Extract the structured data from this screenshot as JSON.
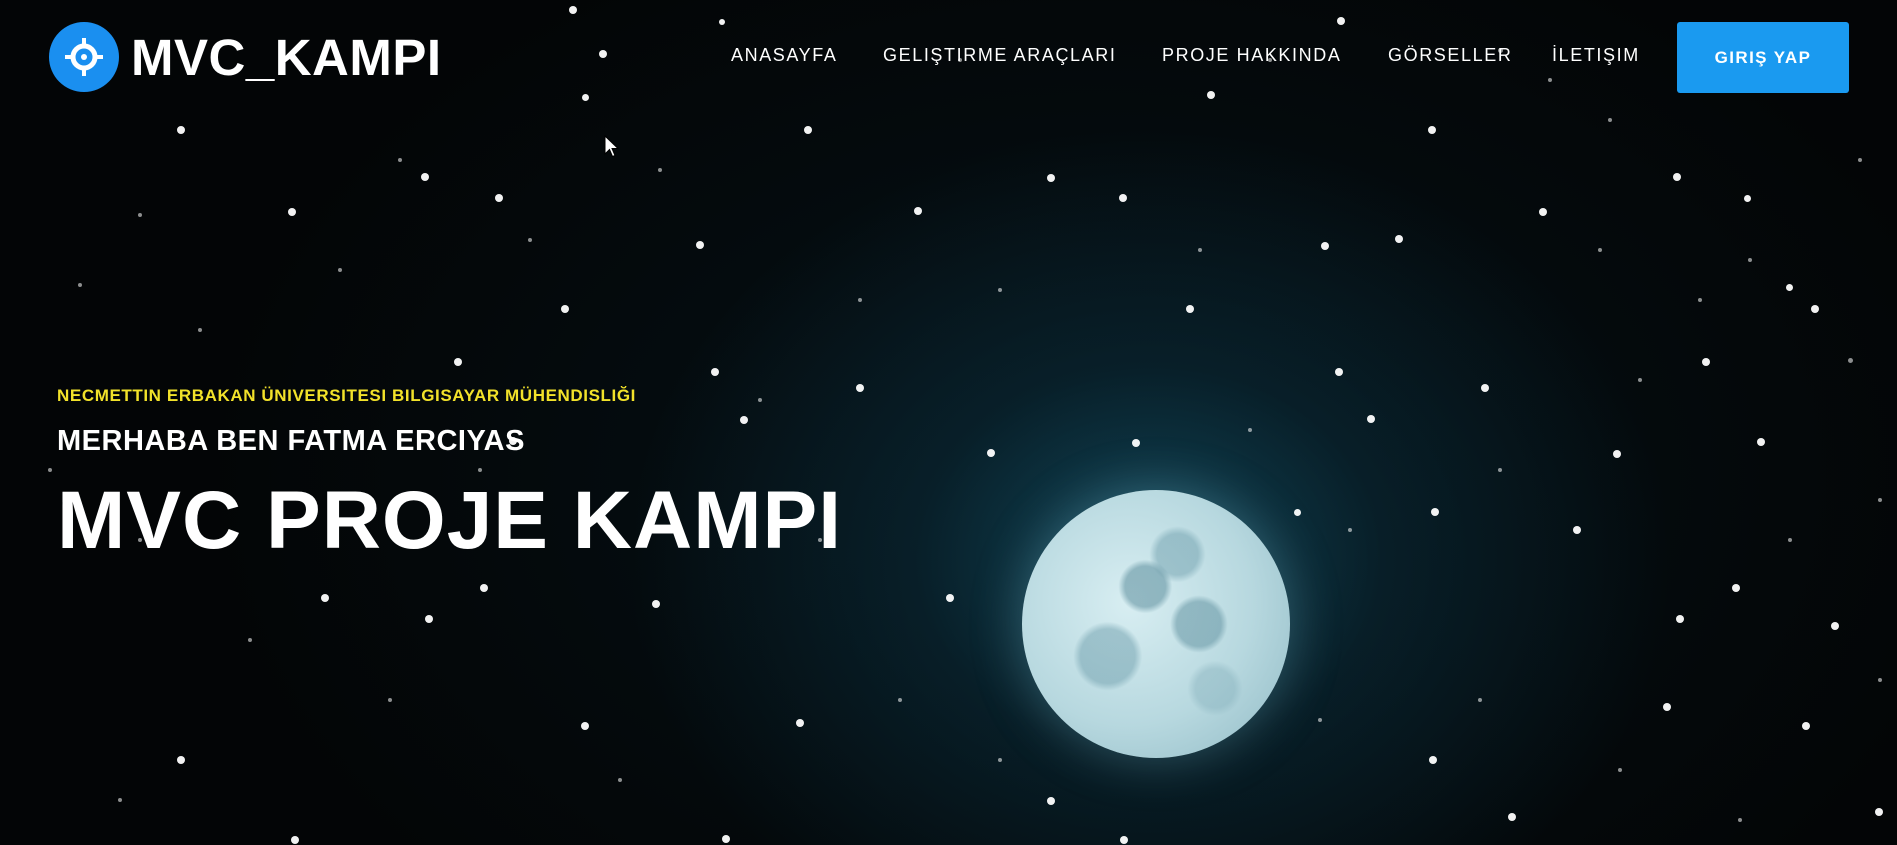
{
  "brand": {
    "name": "MVC_KAMPI",
    "icon": "crosshair-icon",
    "icon_color": "#1a8ff0"
  },
  "nav": {
    "items": [
      {
        "label": "ANASAYFA"
      },
      {
        "label": "GELIŞTIRME ARAÇLARI"
      },
      {
        "label": "PROJE HAKKINDA"
      },
      {
        "label": "GÖRSELLER"
      },
      {
        "label": "İLETIŞIM"
      }
    ],
    "login_label": "GIRIŞ YAP",
    "login_color": "#1a9af0"
  },
  "hero": {
    "subtitle": "NECMETTIN ERBAKAN ÜNIVERSITESI BILGISAYAR MÜHENDISLIĞI",
    "subtitle_color": "#f2e22a",
    "greeting": "MERHABA BEN FATMA ERCIYAS",
    "title": "MVC PROJE KAMPI",
    "background": "night-sky-with-full-moon"
  }
}
